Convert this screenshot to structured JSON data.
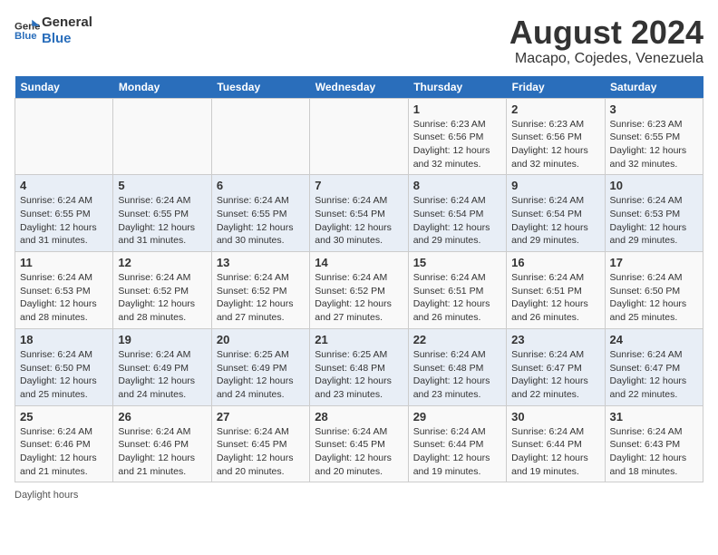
{
  "header": {
    "logo_line1": "General",
    "logo_line2": "Blue",
    "title": "August 2024",
    "subtitle": "Macapo, Cojedes, Venezuela"
  },
  "days_of_week": [
    "Sunday",
    "Monday",
    "Tuesday",
    "Wednesday",
    "Thursday",
    "Friday",
    "Saturday"
  ],
  "weeks": [
    [
      {
        "day": "",
        "info": ""
      },
      {
        "day": "",
        "info": ""
      },
      {
        "day": "",
        "info": ""
      },
      {
        "day": "",
        "info": ""
      },
      {
        "day": "1",
        "info": "Sunrise: 6:23 AM\nSunset: 6:56 PM\nDaylight: 12 hours\nand 32 minutes."
      },
      {
        "day": "2",
        "info": "Sunrise: 6:23 AM\nSunset: 6:56 PM\nDaylight: 12 hours\nand 32 minutes."
      },
      {
        "day": "3",
        "info": "Sunrise: 6:23 AM\nSunset: 6:55 PM\nDaylight: 12 hours\nand 32 minutes."
      }
    ],
    [
      {
        "day": "4",
        "info": "Sunrise: 6:24 AM\nSunset: 6:55 PM\nDaylight: 12 hours\nand 31 minutes."
      },
      {
        "day": "5",
        "info": "Sunrise: 6:24 AM\nSunset: 6:55 PM\nDaylight: 12 hours\nand 31 minutes."
      },
      {
        "day": "6",
        "info": "Sunrise: 6:24 AM\nSunset: 6:55 PM\nDaylight: 12 hours\nand 30 minutes."
      },
      {
        "day": "7",
        "info": "Sunrise: 6:24 AM\nSunset: 6:54 PM\nDaylight: 12 hours\nand 30 minutes."
      },
      {
        "day": "8",
        "info": "Sunrise: 6:24 AM\nSunset: 6:54 PM\nDaylight: 12 hours\nand 29 minutes."
      },
      {
        "day": "9",
        "info": "Sunrise: 6:24 AM\nSunset: 6:54 PM\nDaylight: 12 hours\nand 29 minutes."
      },
      {
        "day": "10",
        "info": "Sunrise: 6:24 AM\nSunset: 6:53 PM\nDaylight: 12 hours\nand 29 minutes."
      }
    ],
    [
      {
        "day": "11",
        "info": "Sunrise: 6:24 AM\nSunset: 6:53 PM\nDaylight: 12 hours\nand 28 minutes."
      },
      {
        "day": "12",
        "info": "Sunrise: 6:24 AM\nSunset: 6:52 PM\nDaylight: 12 hours\nand 28 minutes."
      },
      {
        "day": "13",
        "info": "Sunrise: 6:24 AM\nSunset: 6:52 PM\nDaylight: 12 hours\nand 27 minutes."
      },
      {
        "day": "14",
        "info": "Sunrise: 6:24 AM\nSunset: 6:52 PM\nDaylight: 12 hours\nand 27 minutes."
      },
      {
        "day": "15",
        "info": "Sunrise: 6:24 AM\nSunset: 6:51 PM\nDaylight: 12 hours\nand 26 minutes."
      },
      {
        "day": "16",
        "info": "Sunrise: 6:24 AM\nSunset: 6:51 PM\nDaylight: 12 hours\nand 26 minutes."
      },
      {
        "day": "17",
        "info": "Sunrise: 6:24 AM\nSunset: 6:50 PM\nDaylight: 12 hours\nand 25 minutes."
      }
    ],
    [
      {
        "day": "18",
        "info": "Sunrise: 6:24 AM\nSunset: 6:50 PM\nDaylight: 12 hours\nand 25 minutes."
      },
      {
        "day": "19",
        "info": "Sunrise: 6:24 AM\nSunset: 6:49 PM\nDaylight: 12 hours\nand 24 minutes."
      },
      {
        "day": "20",
        "info": "Sunrise: 6:25 AM\nSunset: 6:49 PM\nDaylight: 12 hours\nand 24 minutes."
      },
      {
        "day": "21",
        "info": "Sunrise: 6:25 AM\nSunset: 6:48 PM\nDaylight: 12 hours\nand 23 minutes."
      },
      {
        "day": "22",
        "info": "Sunrise: 6:24 AM\nSunset: 6:48 PM\nDaylight: 12 hours\nand 23 minutes."
      },
      {
        "day": "23",
        "info": "Sunrise: 6:24 AM\nSunset: 6:47 PM\nDaylight: 12 hours\nand 22 minutes."
      },
      {
        "day": "24",
        "info": "Sunrise: 6:24 AM\nSunset: 6:47 PM\nDaylight: 12 hours\nand 22 minutes."
      }
    ],
    [
      {
        "day": "25",
        "info": "Sunrise: 6:24 AM\nSunset: 6:46 PM\nDaylight: 12 hours\nand 21 minutes."
      },
      {
        "day": "26",
        "info": "Sunrise: 6:24 AM\nSunset: 6:46 PM\nDaylight: 12 hours\nand 21 minutes."
      },
      {
        "day": "27",
        "info": "Sunrise: 6:24 AM\nSunset: 6:45 PM\nDaylight: 12 hours\nand 20 minutes."
      },
      {
        "day": "28",
        "info": "Sunrise: 6:24 AM\nSunset: 6:45 PM\nDaylight: 12 hours\nand 20 minutes."
      },
      {
        "day": "29",
        "info": "Sunrise: 6:24 AM\nSunset: 6:44 PM\nDaylight: 12 hours\nand 19 minutes."
      },
      {
        "day": "30",
        "info": "Sunrise: 6:24 AM\nSunset: 6:44 PM\nDaylight: 12 hours\nand 19 minutes."
      },
      {
        "day": "31",
        "info": "Sunrise: 6:24 AM\nSunset: 6:43 PM\nDaylight: 12 hours\nand 18 minutes."
      }
    ]
  ],
  "footer": "Daylight hours"
}
